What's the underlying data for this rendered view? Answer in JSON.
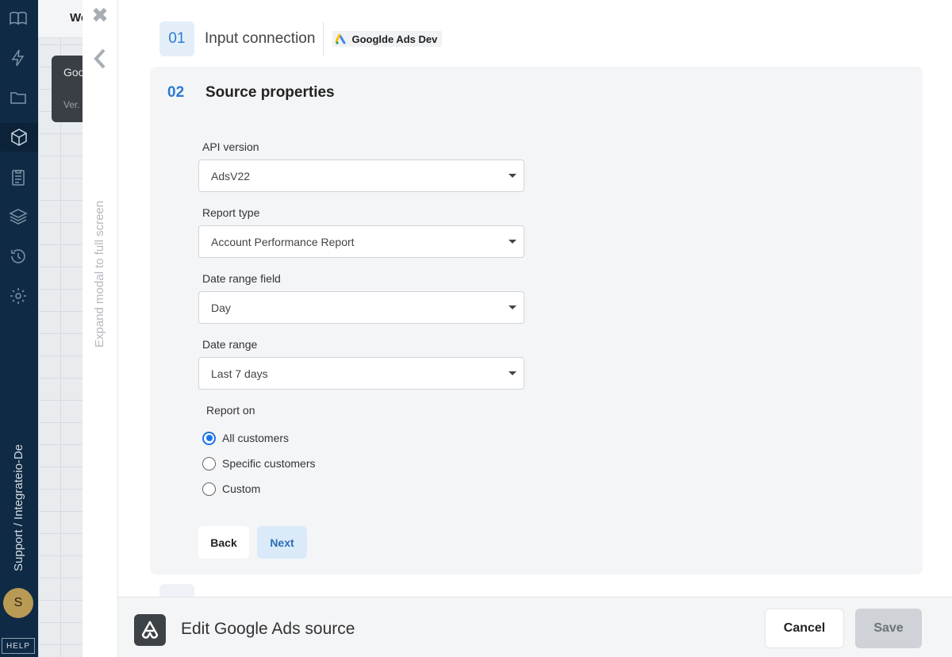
{
  "sidebar": {
    "icons": [
      "book-icon",
      "bolt-icon",
      "folder-icon",
      "package-icon",
      "clipboard-icon",
      "layers-icon",
      "history-icon",
      "settings-icon"
    ],
    "breadcrumb": "Support / Integrateio-De",
    "avatar_initial": "S",
    "help_label": "HELP"
  },
  "workspace": {
    "title": "We",
    "card_name": "Goo",
    "card_sub": "Ver."
  },
  "modal": {
    "expand_label": "Expand modal to full screen",
    "step1": {
      "number": "01",
      "title": "Input connection",
      "connection_name": "Googlde Ads Dev"
    },
    "step2": {
      "number": "02",
      "title": "Source properties"
    },
    "fields": {
      "api_version": {
        "label": "API version",
        "value": "AdsV22"
      },
      "report_type": {
        "label": "Report type",
        "value": "Account Performance Report"
      },
      "date_range_field": {
        "label": "Date range field",
        "value": "Day"
      },
      "date_range": {
        "label": "Date range",
        "value": "Last 7 days"
      }
    },
    "report_on": {
      "label": "Report on",
      "options": [
        "All customers",
        "Specific customers",
        "Custom"
      ],
      "selected": "All customers"
    },
    "buttons": {
      "back": "Back",
      "next": "Next"
    }
  },
  "footer": {
    "title": "Edit Google Ads source",
    "cancel": "Cancel",
    "save": "Save"
  }
}
